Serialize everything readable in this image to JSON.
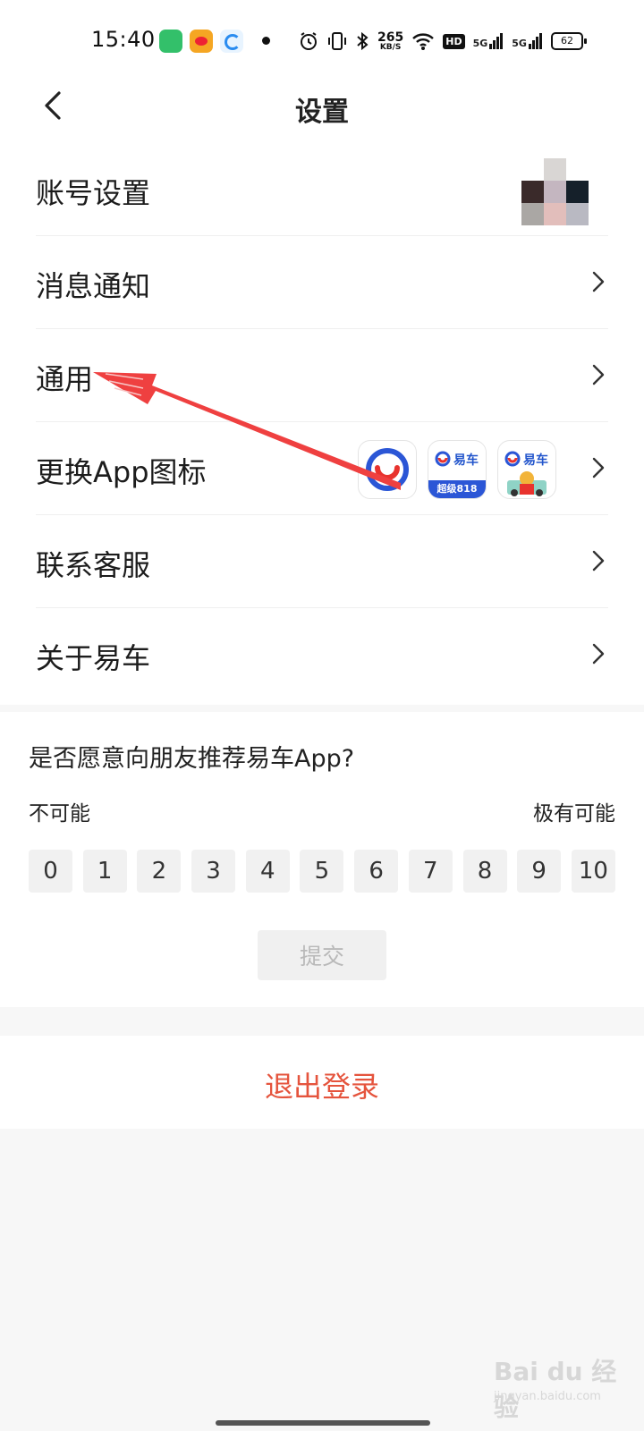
{
  "status_bar": {
    "time": "15:40",
    "net_speed_value": "265",
    "net_speed_unit": "KB/S",
    "hd_badge": "HD",
    "signal1": "5G",
    "signal2": "5G",
    "battery": "62",
    "icons": [
      "wechat-app-icon",
      "weibo-app-icon",
      "browser-app-icon",
      "dot-icon",
      "alarm-icon",
      "vibrate-icon",
      "bluetooth-icon",
      "wifi-icon",
      "signal-icon",
      "battery-icon"
    ]
  },
  "header": {
    "title": "设置",
    "back_icon": "chevron-left-icon"
  },
  "menu": {
    "items": [
      {
        "label": "账号设置",
        "trailing": "avatar"
      },
      {
        "label": "消息通知",
        "trailing": "chevron-right-icon"
      },
      {
        "label": "通用",
        "trailing": "chevron-right-icon"
      },
      {
        "label": "更换App图标",
        "trailing": "app-icon-options"
      },
      {
        "label": "联系客服",
        "trailing": "chevron-right-icon"
      },
      {
        "label": "关于易车",
        "trailing": "chevron-right-icon"
      }
    ],
    "app_icon_options": [
      {
        "name": "yiche-classic-icon",
        "text": ""
      },
      {
        "name": "yiche-818-icon",
        "text": "易车",
        "sub": "超级818"
      },
      {
        "name": "yiche-festival-icon",
        "text": "易车"
      }
    ]
  },
  "annotation": {
    "arrow_color": "#ef4040",
    "points_to": "通用"
  },
  "survey": {
    "question": "是否愿意向朋友推荐易车App?",
    "low_label": "不可能",
    "high_label": "极有可能",
    "scale": [
      "0",
      "1",
      "2",
      "3",
      "4",
      "5",
      "6",
      "7",
      "8",
      "9",
      "10"
    ],
    "submit_label": "提交"
  },
  "logout": {
    "label": "退出登录",
    "color": "#e5543d"
  },
  "watermark": {
    "main": "Bai du 经验",
    "sub": "jingyan.baidu.com"
  }
}
